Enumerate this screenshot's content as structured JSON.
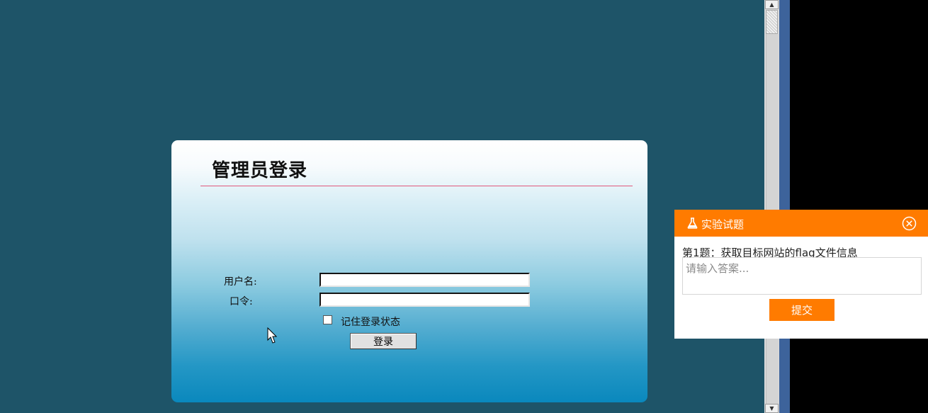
{
  "login": {
    "title": "管理员登录",
    "username_label": "用户名:",
    "password_label": "口令:",
    "remember_label": "记住登录状态",
    "remember_checked": false,
    "login_button": "登录"
  },
  "experiment_panel": {
    "title": "实验试题",
    "question": "第1题：获取目标网站的flag文件信息",
    "answer_placeholder": "请输入答案...",
    "submit_button": "提交",
    "accent_color": "#ff7b00"
  },
  "colors": {
    "desktop_background": "#1e5468",
    "title_rule": "#e0587c"
  },
  "icons": [
    "flask-icon",
    "close-circle-icon",
    "arrow-up-icon",
    "arrow-down-icon",
    "mouse-cursor-icon"
  ]
}
